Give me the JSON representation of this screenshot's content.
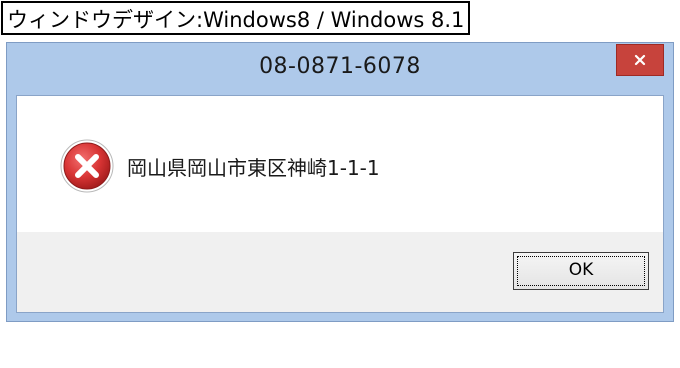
{
  "caption": {
    "text": "ウィンドウデザイン:Windows8 / Windows 8.1"
  },
  "dialog": {
    "title": "08-0871-6078",
    "message": "岡山県岡山市東区神崎1-1-1",
    "ok_label": "OK",
    "icons": {
      "close": "close-icon",
      "message": "error-icon"
    },
    "colors": {
      "title_bar": "#aec9ea",
      "close_button": "#c7433c",
      "error_icon": "#d83434",
      "button_area": "#f0f0f0"
    }
  }
}
